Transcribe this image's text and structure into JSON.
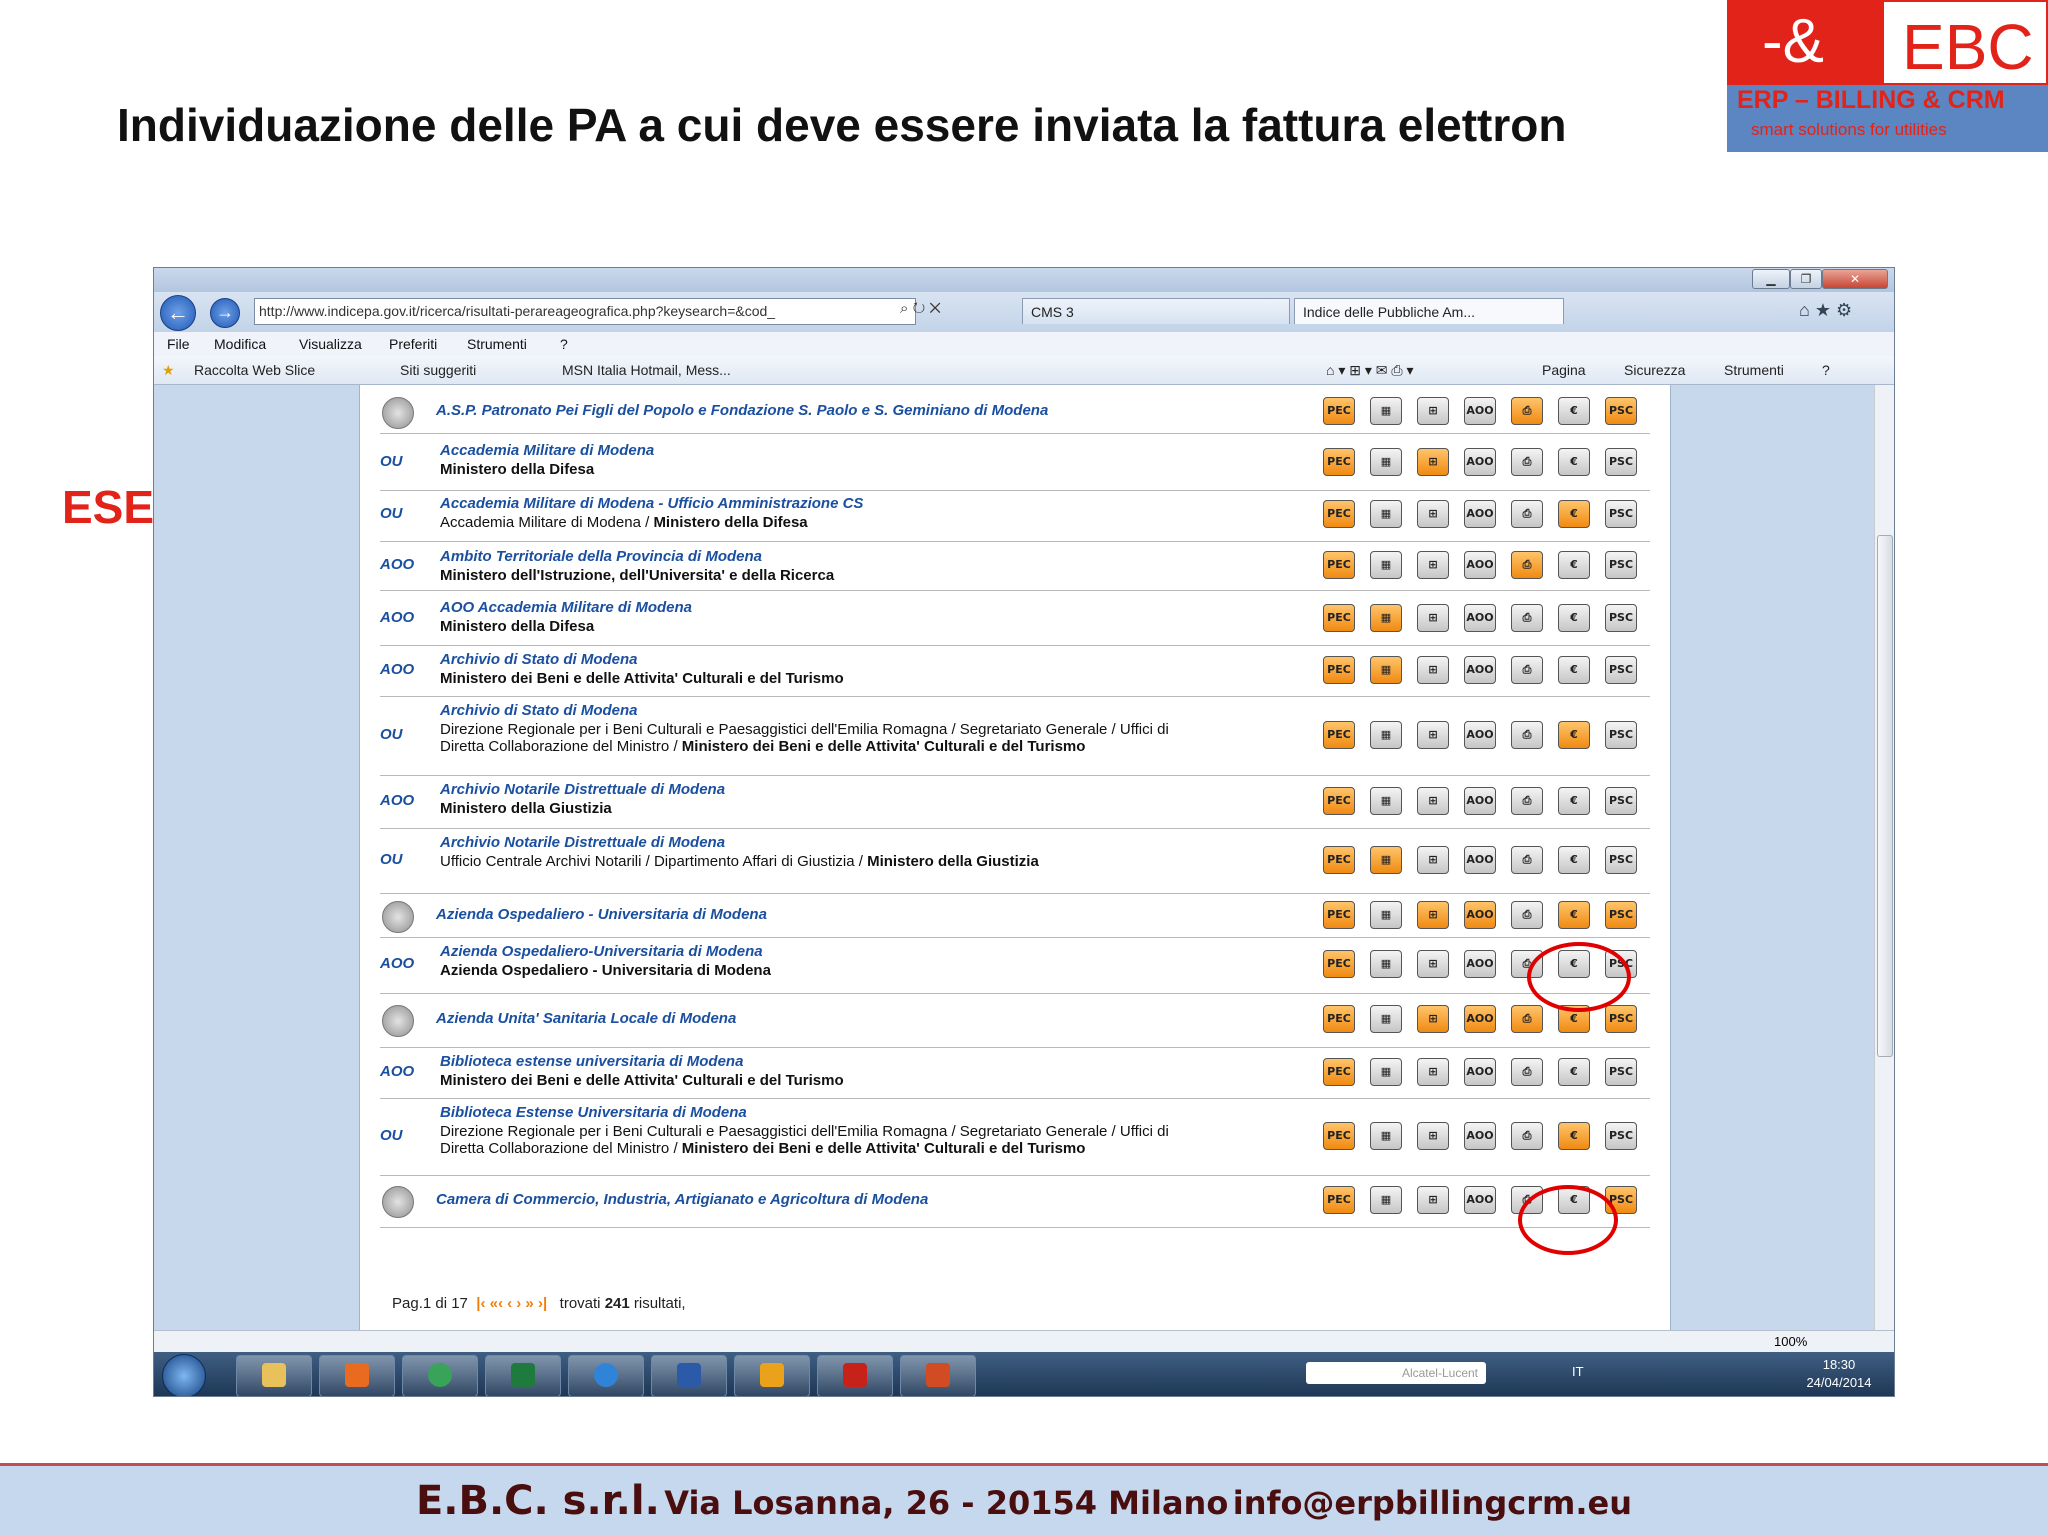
{
  "slide": {
    "title": "Individuazione delle PA a cui deve essere inviata la fattura elettron",
    "example_label": "ESEMPIO",
    "logo": {
      "symbol": "-&",
      "name": "EBC",
      "line1": "ERP – BILLING & CRM",
      "line2": "smart solutions for utilities"
    },
    "footer": {
      "company": "E.B.C. s.r.l.",
      "address": "Via Losanna, 26 - 20154 Milano",
      "email": "info@erpbillingcrm.eu"
    }
  },
  "browser": {
    "address": "http://www.indicepa.gov.it/ricerca/risultati-perareageografica.php?keysearch=&cod_",
    "tabs": [
      "CMS 3",
      "Indice delle Pubbliche Am..."
    ],
    "menu": [
      "File",
      "Modifica",
      "Visualizza",
      "Preferiti",
      "Strumenti",
      "?"
    ],
    "favorites": [
      "Raccolta Web Slice",
      "Siti suggeriti",
      "MSN Italia Hotmail, Mess..."
    ],
    "command_bar": [
      "Pagina",
      "Sicurezza",
      "Strumenti"
    ],
    "status": {
      "zoom": "100%"
    },
    "taskbar": {
      "search_text": "Alcatel-Lucent",
      "lang": "IT",
      "time": "18:30",
      "date": "24/04/2014"
    }
  },
  "results": [
    {
      "type": "",
      "title": "A.S.P. Patronato Pei Figli del Popolo e Fondazione S. Paolo e S. Geminiano di Modena",
      "sub": "",
      "sub_bold": "",
      "emblem": true,
      "icons": [
        1,
        0,
        0,
        0,
        1,
        0,
        1
      ]
    },
    {
      "type": "OU",
      "title": "Accademia Militare di Modena",
      "sub": "",
      "sub_bold": "Ministero della Difesa",
      "icons": [
        1,
        0,
        1,
        0,
        0,
        0,
        0
      ]
    },
    {
      "type": "OU",
      "title": "Accademia Militare di Modena - Ufficio Amministrazione CS",
      "sub": "Accademia Militare di Modena / ",
      "sub_bold": "Ministero della Difesa",
      "icons": [
        1,
        0,
        0,
        0,
        0,
        1,
        0
      ]
    },
    {
      "type": "AOO",
      "title": "Ambito Territoriale della Provincia di Modena",
      "sub": "",
      "sub_bold": "Ministero dell'Istruzione, dell'Universita' e della Ricerca",
      "icons": [
        1,
        0,
        0,
        0,
        1,
        0,
        0
      ]
    },
    {
      "type": "AOO",
      "title": "AOO Accademia Militare di Modena",
      "sub": "",
      "sub_bold": "Ministero della Difesa",
      "icons": [
        1,
        1,
        0,
        0,
        0,
        0,
        0
      ]
    },
    {
      "type": "AOO",
      "title": "Archivio di Stato di Modena",
      "sub": "",
      "sub_bold": "Ministero dei Beni e delle Attivita' Culturali e del Turismo",
      "icons": [
        1,
        1,
        0,
        0,
        0,
        0,
        0
      ]
    },
    {
      "type": "OU",
      "title": "Archivio di Stato di Modena",
      "sub": "Direzione Regionale per i Beni Culturali e Paesaggistici dell'Emilia Romagna / Segretariato Generale / Uffici di",
      "sub2": "Diretta Collaborazione del Ministro / ",
      "sub_bold": "Ministero dei Beni e delle Attivita' Culturali e del Turismo",
      "icons": [
        1,
        0,
        0,
        0,
        0,
        1,
        0
      ]
    },
    {
      "type": "AOO",
      "title": "Archivio Notarile Distrettuale di Modena",
      "sub": "",
      "sub_bold": "Ministero della Giustizia",
      "icons": [
        1,
        0,
        0,
        0,
        0,
        0,
        0
      ]
    },
    {
      "type": "OU",
      "title": "Archivio Notarile Distrettuale di Modena",
      "sub": "Ufficio Centrale Archivi Notarili / Dipartimento Affari di Giustizia / ",
      "sub_bold": "Ministero della Giustizia",
      "icons": [
        1,
        1,
        0,
        0,
        0,
        0,
        0
      ]
    },
    {
      "type": "",
      "title": "Azienda Ospedaliero - Universitaria di Modena",
      "sub": "",
      "sub_bold": "",
      "emblem": true,
      "icons": [
        1,
        0,
        1,
        1,
        0,
        1,
        1
      ]
    },
    {
      "type": "AOO",
      "title": "Azienda Ospedaliero-Universitaria di Modena",
      "sub": "",
      "sub_bold": "Azienda Ospedaliero - Universitaria di Modena",
      "icons": [
        1,
        0,
        0,
        0,
        0,
        0,
        0
      ]
    },
    {
      "type": "",
      "title": "Azienda Unita' Sanitaria Locale di Modena",
      "sub": "",
      "sub_bold": "",
      "emblem": true,
      "icons": [
        1,
        0,
        1,
        1,
        1,
        1,
        1
      ]
    },
    {
      "type": "AOO",
      "title": "Biblioteca estense universitaria di Modena",
      "sub": "",
      "sub_bold": "Ministero dei Beni e delle Attivita' Culturali e del Turismo",
      "icons": [
        1,
        0,
        0,
        0,
        0,
        0,
        0
      ]
    },
    {
      "type": "OU",
      "title": "Biblioteca Estense Universitaria di Modena",
      "sub": "Direzione Regionale per i Beni Culturali e Paesaggistici dell'Emilia Romagna / Segretariato Generale / Uffici di",
      "sub2": "Diretta Collaborazione del Ministro / ",
      "sub_bold": "Ministero dei Beni e delle Attivita' Culturali e del Turismo",
      "icons": [
        1,
        0,
        0,
        0,
        0,
        1,
        0
      ]
    },
    {
      "type": "",
      "title": "Camera di Commercio, Industria, Artigianato e Agricoltura di Modena",
      "sub": "",
      "sub_bold": "",
      "emblem": true,
      "icons": [
        1,
        0,
        0,
        0,
        0,
        0,
        1
      ]
    }
  ],
  "icon_labels": [
    "PEC",
    "",
    "",
    "AOO",
    "",
    "€",
    "PSC"
  ],
  "pager": {
    "page_text": "Pag.1 di 17",
    "found_text": "trovati",
    "count": "241",
    "suffix": "risultati,"
  }
}
